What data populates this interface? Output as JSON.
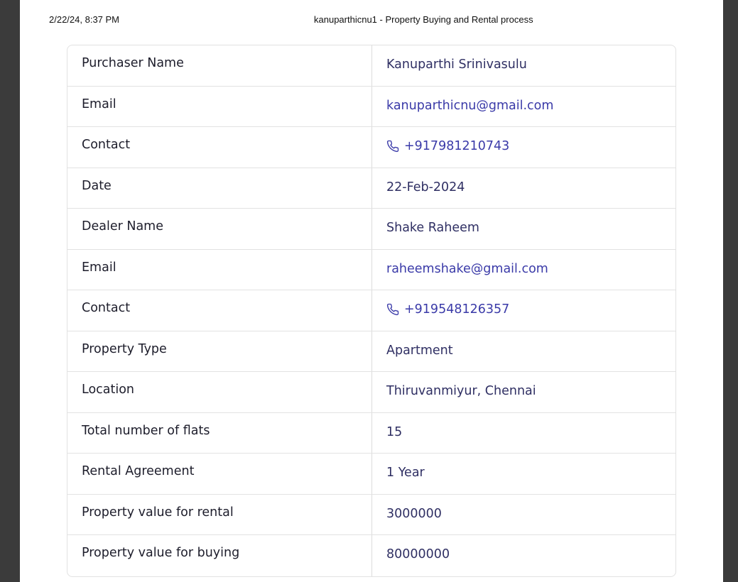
{
  "print_header": {
    "date": "2/22/24, 8:37 PM",
    "title": "kanuparthicnu1 - Property Buying and Rental process"
  },
  "rows": [
    {
      "label": "Purchaser Name",
      "value": "Kanuparthi Srinivasulu",
      "kind": "text"
    },
    {
      "label": "Email",
      "value": "kanuparthicnu@gmail.com",
      "kind": "email"
    },
    {
      "label": "Contact",
      "value": "+917981210743",
      "kind": "phone",
      "icon": "phone-icon"
    },
    {
      "label": "Date",
      "value": "22-Feb-2024",
      "kind": "text"
    },
    {
      "label": "Dealer Name",
      "value": "Shake Raheem",
      "kind": "text"
    },
    {
      "label": "Email",
      "value": "raheemshake@gmail.com",
      "kind": "email"
    },
    {
      "label": "Contact",
      "value": "+919548126357",
      "kind": "phone",
      "icon": "phone-icon"
    },
    {
      "label": "Property Type",
      "value": "Apartment",
      "kind": "text"
    },
    {
      "label": "Location",
      "value": "Thiruvanmiyur, Chennai",
      "kind": "text"
    },
    {
      "label": "Total number of flats",
      "value": "15",
      "kind": "text"
    },
    {
      "label": "Rental Agreement",
      "value": "1 Year",
      "kind": "text"
    },
    {
      "label": "Property value for rental",
      "value": "3000000",
      "kind": "text"
    },
    {
      "label": "Property value for buying",
      "value": "80000000",
      "kind": "text"
    }
  ],
  "colors": {
    "link": "#3a3aa8",
    "value_text": "#2f2f63",
    "label_text": "#1d1d2b",
    "border": "#e2e2e2",
    "viewer_background": "#3b3b3b"
  }
}
